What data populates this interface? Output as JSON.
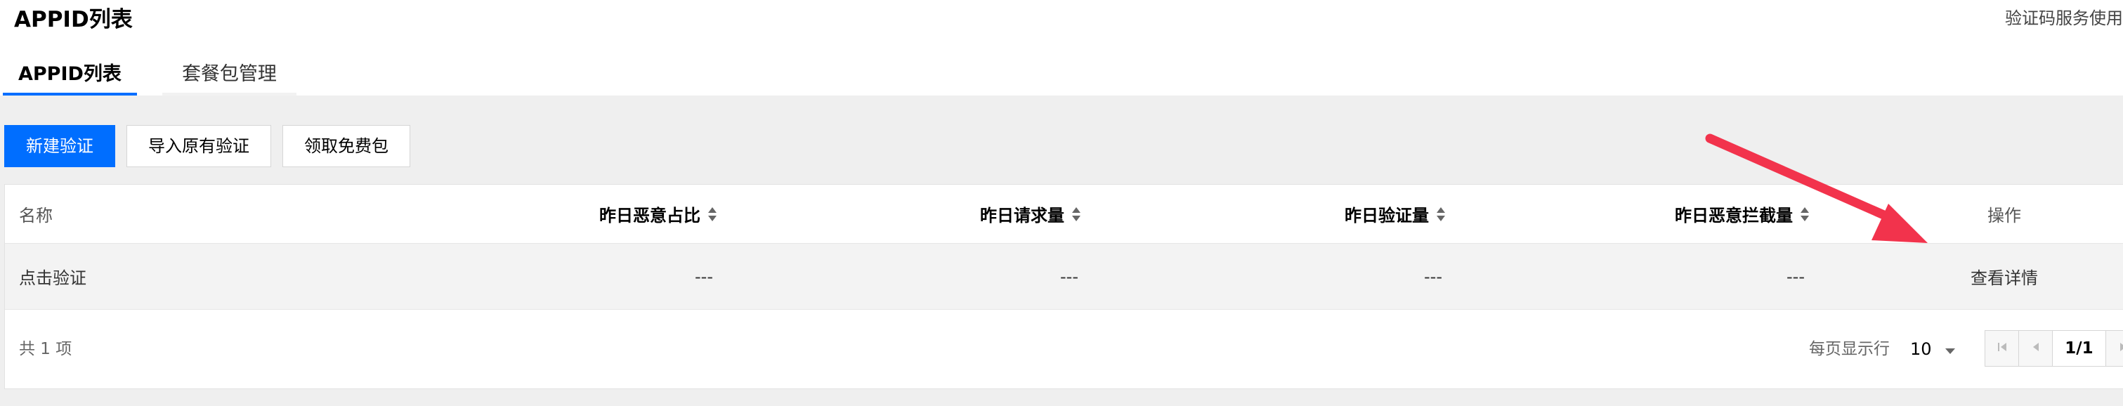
{
  "header": {
    "title": "APPID列表",
    "top_right_link": "验证码服务使用"
  },
  "tabs": [
    {
      "label": "APPID列表",
      "active": true
    },
    {
      "label": "套餐包管理",
      "active": false
    }
  ],
  "toolbar": {
    "new_label": "新建验证",
    "import_label": "导入原有验证",
    "free_label": "领取免费包"
  },
  "table": {
    "columns": {
      "name": "名称",
      "malicious_ratio": "昨日恶意占比",
      "requests": "昨日请求量",
      "verifications": "昨日验证量",
      "blocked": "昨日恶意拦截量",
      "actions": "操作"
    },
    "rows": [
      {
        "name": "点击验证",
        "malicious_ratio": "---",
        "requests": "---",
        "verifications": "---",
        "blocked": "---",
        "action": "查看详情"
      }
    ]
  },
  "footer": {
    "total": "共 1 项",
    "per_page_label": "每页显示行",
    "per_page_value": "10",
    "page_indicator": "1/1"
  },
  "colors": {
    "accent": "#006eff",
    "annotation_arrow": "#f2334c",
    "page_bg": "#efefef"
  }
}
